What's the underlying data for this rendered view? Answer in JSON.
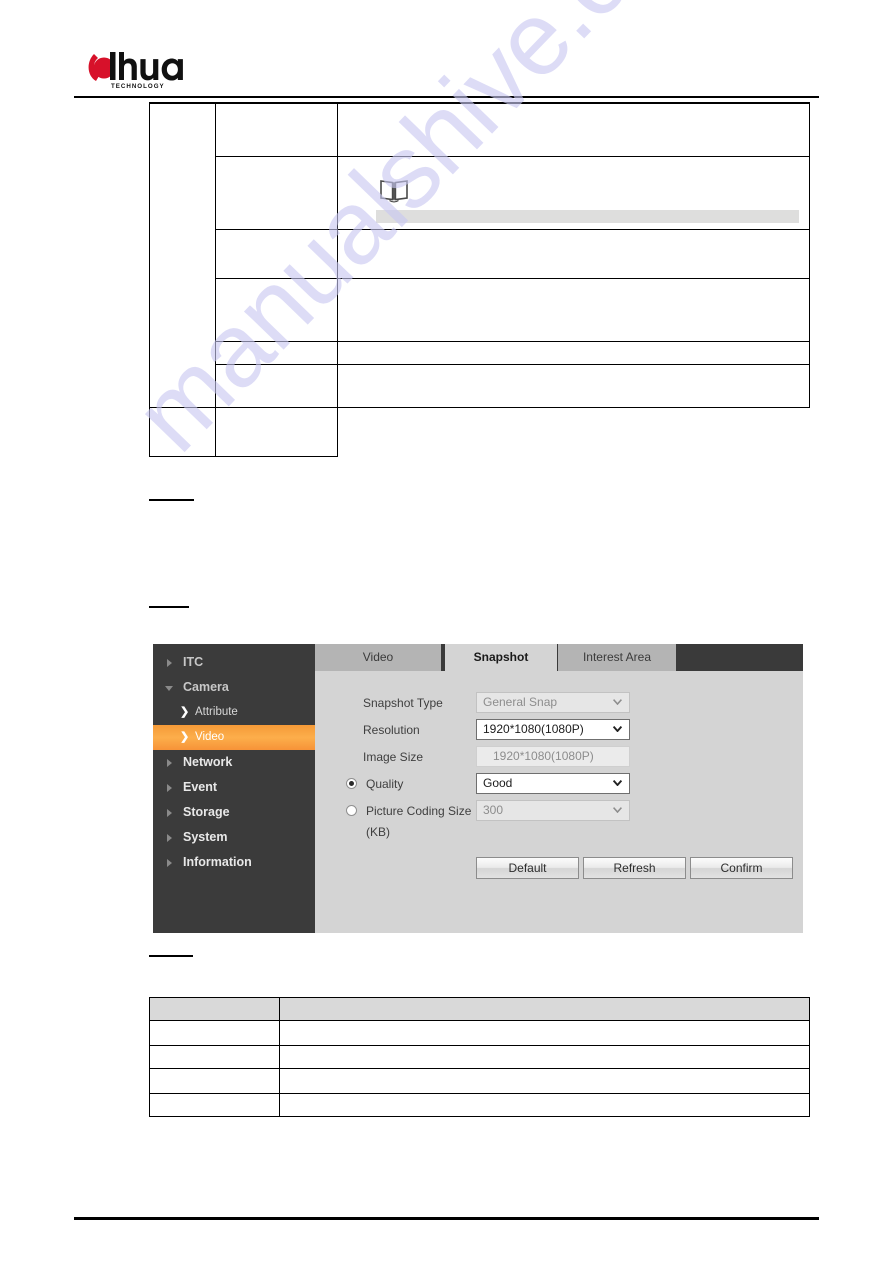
{
  "document": {
    "brand": "dahua",
    "brand_sub": "TECHNOLOGY",
    "watermark": "manualshive.com"
  },
  "table_top": {
    "columns": 3,
    "header": [
      "",
      "",
      ""
    ],
    "rows": [
      [
        "",
        "",
        ""
      ],
      [
        "",
        "",
        ""
      ],
      [
        "",
        "",
        ""
      ],
      [
        "",
        "",
        ""
      ],
      [
        "",
        "",
        ""
      ],
      [
        "",
        "",
        ""
      ]
    ],
    "note_icon": "open-book-note-icon"
  },
  "table_bottom": {
    "columns": 2,
    "header": [
      "",
      ""
    ],
    "rows": [
      [
        "",
        ""
      ],
      [
        "",
        ""
      ],
      [
        "",
        ""
      ],
      [
        "",
        ""
      ]
    ]
  },
  "webui": {
    "sidebar": {
      "items": [
        {
          "label": "ITC",
          "level": "top",
          "arrow": "right",
          "state": "dim",
          "chevron": ""
        },
        {
          "label": "Camera",
          "level": "top",
          "arrow": "down",
          "state": "dim",
          "chevron": ""
        },
        {
          "label": "Attribute",
          "level": "sub",
          "arrow": "none",
          "state": "normal",
          "chevron": "❯"
        },
        {
          "label": "Video",
          "level": "sub",
          "arrow": "none",
          "state": "active",
          "chevron": "❯"
        },
        {
          "label": "Network",
          "level": "top",
          "arrow": "right",
          "state": "normal",
          "chevron": ""
        },
        {
          "label": "Event",
          "level": "top",
          "arrow": "right",
          "state": "normal",
          "chevron": ""
        },
        {
          "label": "Storage",
          "level": "top",
          "arrow": "right",
          "state": "normal",
          "chevron": ""
        },
        {
          "label": "System",
          "level": "top",
          "arrow": "right",
          "state": "normal",
          "chevron": ""
        },
        {
          "label": "Information",
          "level": "top",
          "arrow": "right",
          "state": "normal",
          "chevron": ""
        }
      ],
      "active_color": "#F89A3C",
      "background_color": "#3B3B3B"
    },
    "tabs": [
      {
        "label": "Video",
        "active": false
      },
      {
        "label": "Snapshot",
        "active": true
      },
      {
        "label": "Interest Area",
        "active": false
      }
    ],
    "form": {
      "snapshot_type": {
        "label": "Snapshot Type",
        "value": "General Snap",
        "control": "select",
        "enabled": false
      },
      "resolution": {
        "label": "Resolution",
        "value": "1920*1080(1080P)",
        "control": "select",
        "enabled": true
      },
      "image_size": {
        "label": "Image Size",
        "value": "1920*1080(1080P)",
        "control": "readonly-text",
        "enabled": false
      },
      "quality": {
        "label": "Quality",
        "value": "Good",
        "control": "select",
        "enabled": true,
        "radio_selected": true
      },
      "picture_coding_size": {
        "label": "Picture Coding Size",
        "label_unit": "(KB)",
        "value": "300",
        "control": "select",
        "enabled": false,
        "radio_selected": false
      }
    },
    "buttons": [
      {
        "label": "Default"
      },
      {
        "label": "Refresh"
      },
      {
        "label": "Confirm"
      }
    ]
  }
}
